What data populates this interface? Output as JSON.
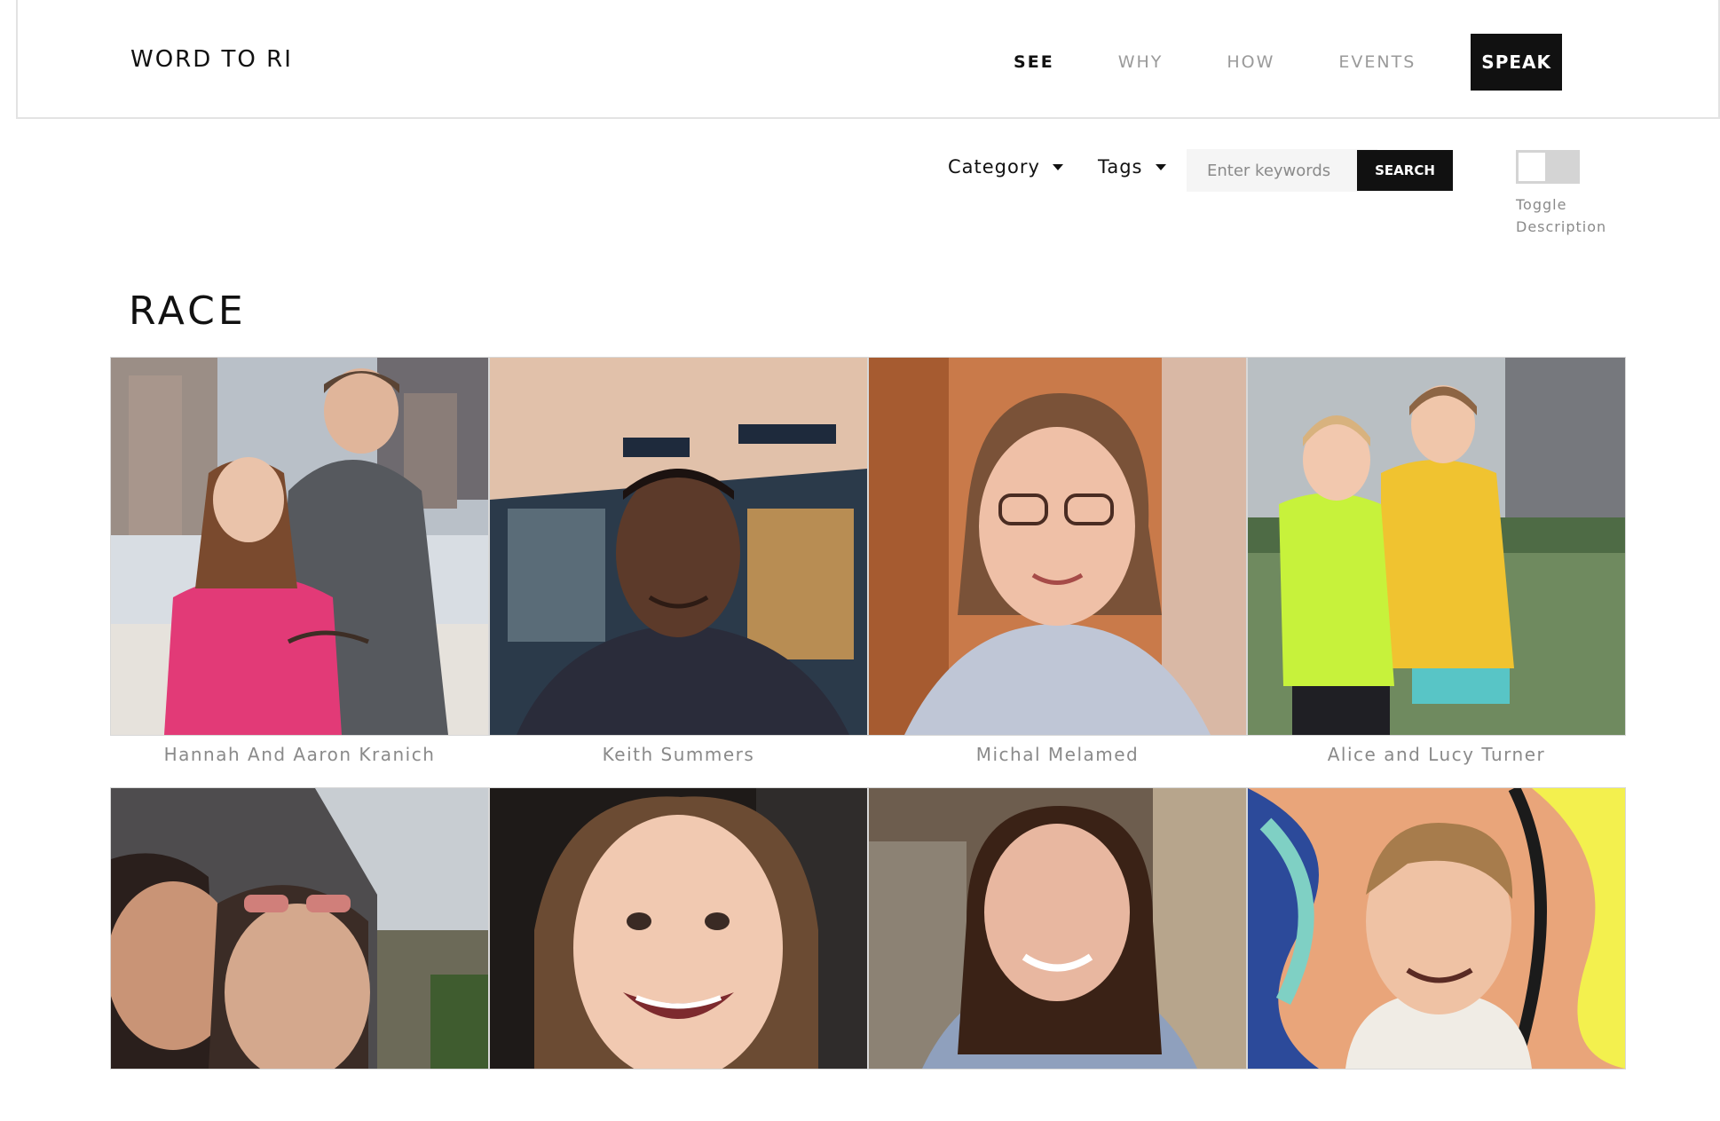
{
  "header": {
    "brand": "WORD TO RI",
    "nav": [
      {
        "label": "SEE"
      },
      {
        "label": "WHY"
      },
      {
        "label": "HOW"
      },
      {
        "label": "EVENTS"
      },
      {
        "label": "SPEAK"
      }
    ]
  },
  "filters": {
    "category_label": "Category",
    "tags_label": "Tags",
    "search_placeholder": "Enter keywords",
    "search_button": "SEARCH",
    "toggle_label": "Toggle Description",
    "toggle_on": false
  },
  "page": {
    "title": "RACE"
  },
  "gallery": [
    {
      "caption": "Hannah And Aaron Kranich"
    },
    {
      "caption": "Keith Summers"
    },
    {
      "caption": "Michal Melamed"
    },
    {
      "caption": "Alice and Lucy Turner"
    },
    {
      "caption": ""
    },
    {
      "caption": ""
    },
    {
      "caption": ""
    },
    {
      "caption": ""
    }
  ],
  "colors": {
    "accent": "#111111",
    "muted_text": "#8a8a8a"
  }
}
